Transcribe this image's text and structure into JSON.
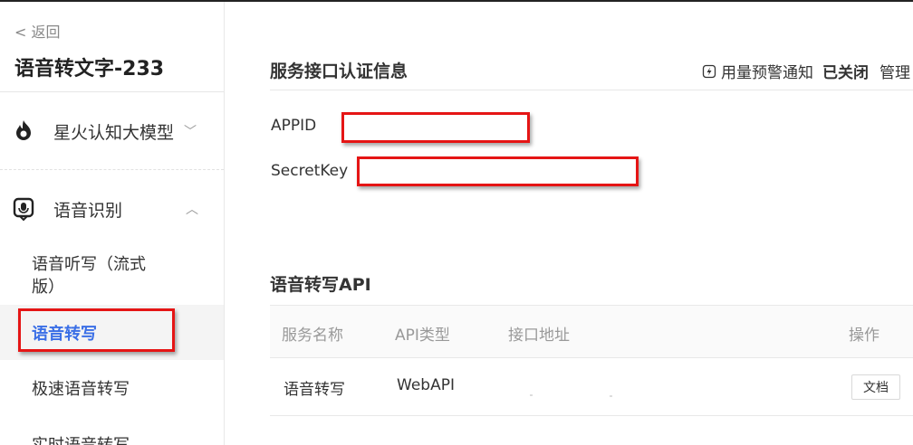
{
  "sidebar": {
    "back_label": "< 返回",
    "app_title": "语音转文字-233",
    "groups": [
      {
        "label": "星火认知大模型",
        "icon": "flame-icon",
        "chevron": "﹀"
      },
      {
        "label": "语音识别",
        "icon": "voice-recognition-icon",
        "chevron": "︿"
      }
    ],
    "sub_items": [
      {
        "label": "语音听写（流式版）"
      },
      {
        "label": "语音转写"
      },
      {
        "label": "极速语音转写"
      },
      {
        "label": "实时语音转写"
      }
    ]
  },
  "auth": {
    "section_title": "服务接口认证信息",
    "alert_label": "用量预警通知",
    "alert_status": "已关闭",
    "manage_label": "管理",
    "fields": [
      {
        "label": "APPID",
        "value": ""
      },
      {
        "label": "SecretKey",
        "value": ""
      }
    ]
  },
  "api": {
    "section_title": "语音转写API",
    "columns": [
      "服务名称",
      "API类型",
      "接口地址",
      "操作"
    ],
    "rows": [
      {
        "name": "语音转写",
        "type": "WebAPI",
        "address": "",
        "action": "文档"
      }
    ]
  },
  "colors": {
    "accent": "#3b6fe6",
    "highlight_border": "#e51515"
  }
}
